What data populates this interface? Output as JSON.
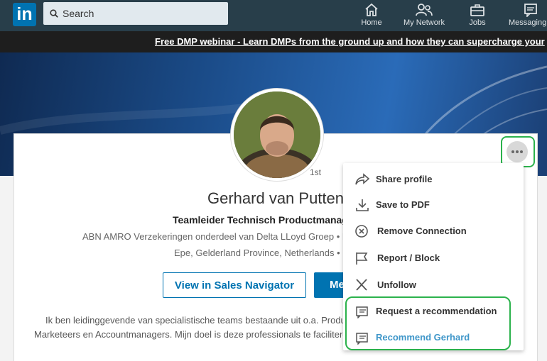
{
  "nav": {
    "logo": "in",
    "search_placeholder": "Search",
    "items": [
      {
        "label": "Home",
        "icon": "home-icon"
      },
      {
        "label": "My Network",
        "icon": "network-icon"
      },
      {
        "label": "Jobs",
        "icon": "briefcase-icon"
      },
      {
        "label": "Messaging",
        "icon": "messaging-icon"
      }
    ]
  },
  "banner": {
    "ad_text": "Free DMP webinar - Learn DMPs from the ground up and how they can supercharge your"
  },
  "profile": {
    "degree": "1st",
    "name": "Gerhard van Putten",
    "headline": "Teamleider Technisch Productmanag",
    "company": "ABN AMRO Verzekeringen onderdeel van Delta LLoyd Groep • Fi",
    "location": "Epe, Gelderland Province, Netherlands •",
    "buttons": {
      "sales_navigator": "View in Sales Navigator",
      "message": "Me"
    },
    "about_line1": "Ik ben leidinggevende van specialistische teams bestaande uit o.a. Produ",
    "about_line2": "Marketeers en Accountmanagers. Mijn doel is deze professionals te faciliteren"
  },
  "more_menu": {
    "items": [
      {
        "label": "Share profile",
        "icon": "share-icon"
      },
      {
        "label": "Save to PDF",
        "icon": "download-icon"
      },
      {
        "label": "Remove Connection",
        "icon": "remove-circle-icon"
      },
      {
        "label": "Report / Block",
        "icon": "flag-icon"
      },
      {
        "label": "Unfollow",
        "icon": "close-icon"
      },
      {
        "label": "Request a recommendation",
        "icon": "recommendation-icon"
      },
      {
        "label": "Recommend Gerhard",
        "icon": "recommendation-icon"
      }
    ]
  },
  "colors": {
    "nav_bg": "#283e4a",
    "brand_blue": "#0073b1",
    "highlight_green": "#2bb24c",
    "link_blue": "#3e96c9"
  }
}
